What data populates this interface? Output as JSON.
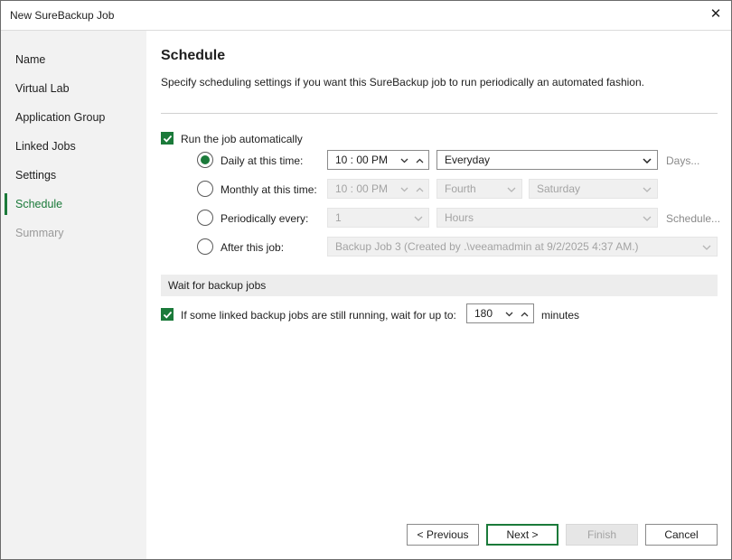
{
  "window": {
    "title": "New SureBackup Job"
  },
  "sidebar": {
    "items": [
      {
        "label": "Name"
      },
      {
        "label": "Virtual Lab"
      },
      {
        "label": "Application Group"
      },
      {
        "label": "Linked Jobs"
      },
      {
        "label": "Settings"
      },
      {
        "label": "Schedule"
      },
      {
        "label": "Summary"
      }
    ]
  },
  "main": {
    "heading": "Schedule",
    "description": "Specify scheduling settings if you want this SureBackup job to run periodically an automated fashion.",
    "run_automatically": {
      "label": "Run the job automatically",
      "checked": true
    },
    "options": {
      "daily": {
        "label": "Daily at this time:",
        "time": "10 : 00 PM",
        "frequency": "Everyday",
        "link": "Days..."
      },
      "monthly": {
        "label": "Monthly at this time:",
        "time": "10 : 00 PM",
        "week": "Fourth",
        "day": "Saturday"
      },
      "periodic": {
        "label": "Periodically every:",
        "value": "1",
        "unit": "Hours",
        "link": "Schedule..."
      },
      "after": {
        "label": "After this job:",
        "job": "Backup Job 3 (Created by .\\veeamadmin at 9/2/2025 4:37 AM.)"
      }
    },
    "wait_section": {
      "title": "Wait for backup jobs",
      "checkbox_label": "If some linked backup jobs are still running, wait for up to:",
      "value": "180",
      "unit": "minutes"
    }
  },
  "footer": {
    "previous": "< Previous",
    "next": "Next >",
    "finish": "Finish",
    "cancel": "Cancel"
  },
  "colors": {
    "accent": "#1b7a3a"
  }
}
